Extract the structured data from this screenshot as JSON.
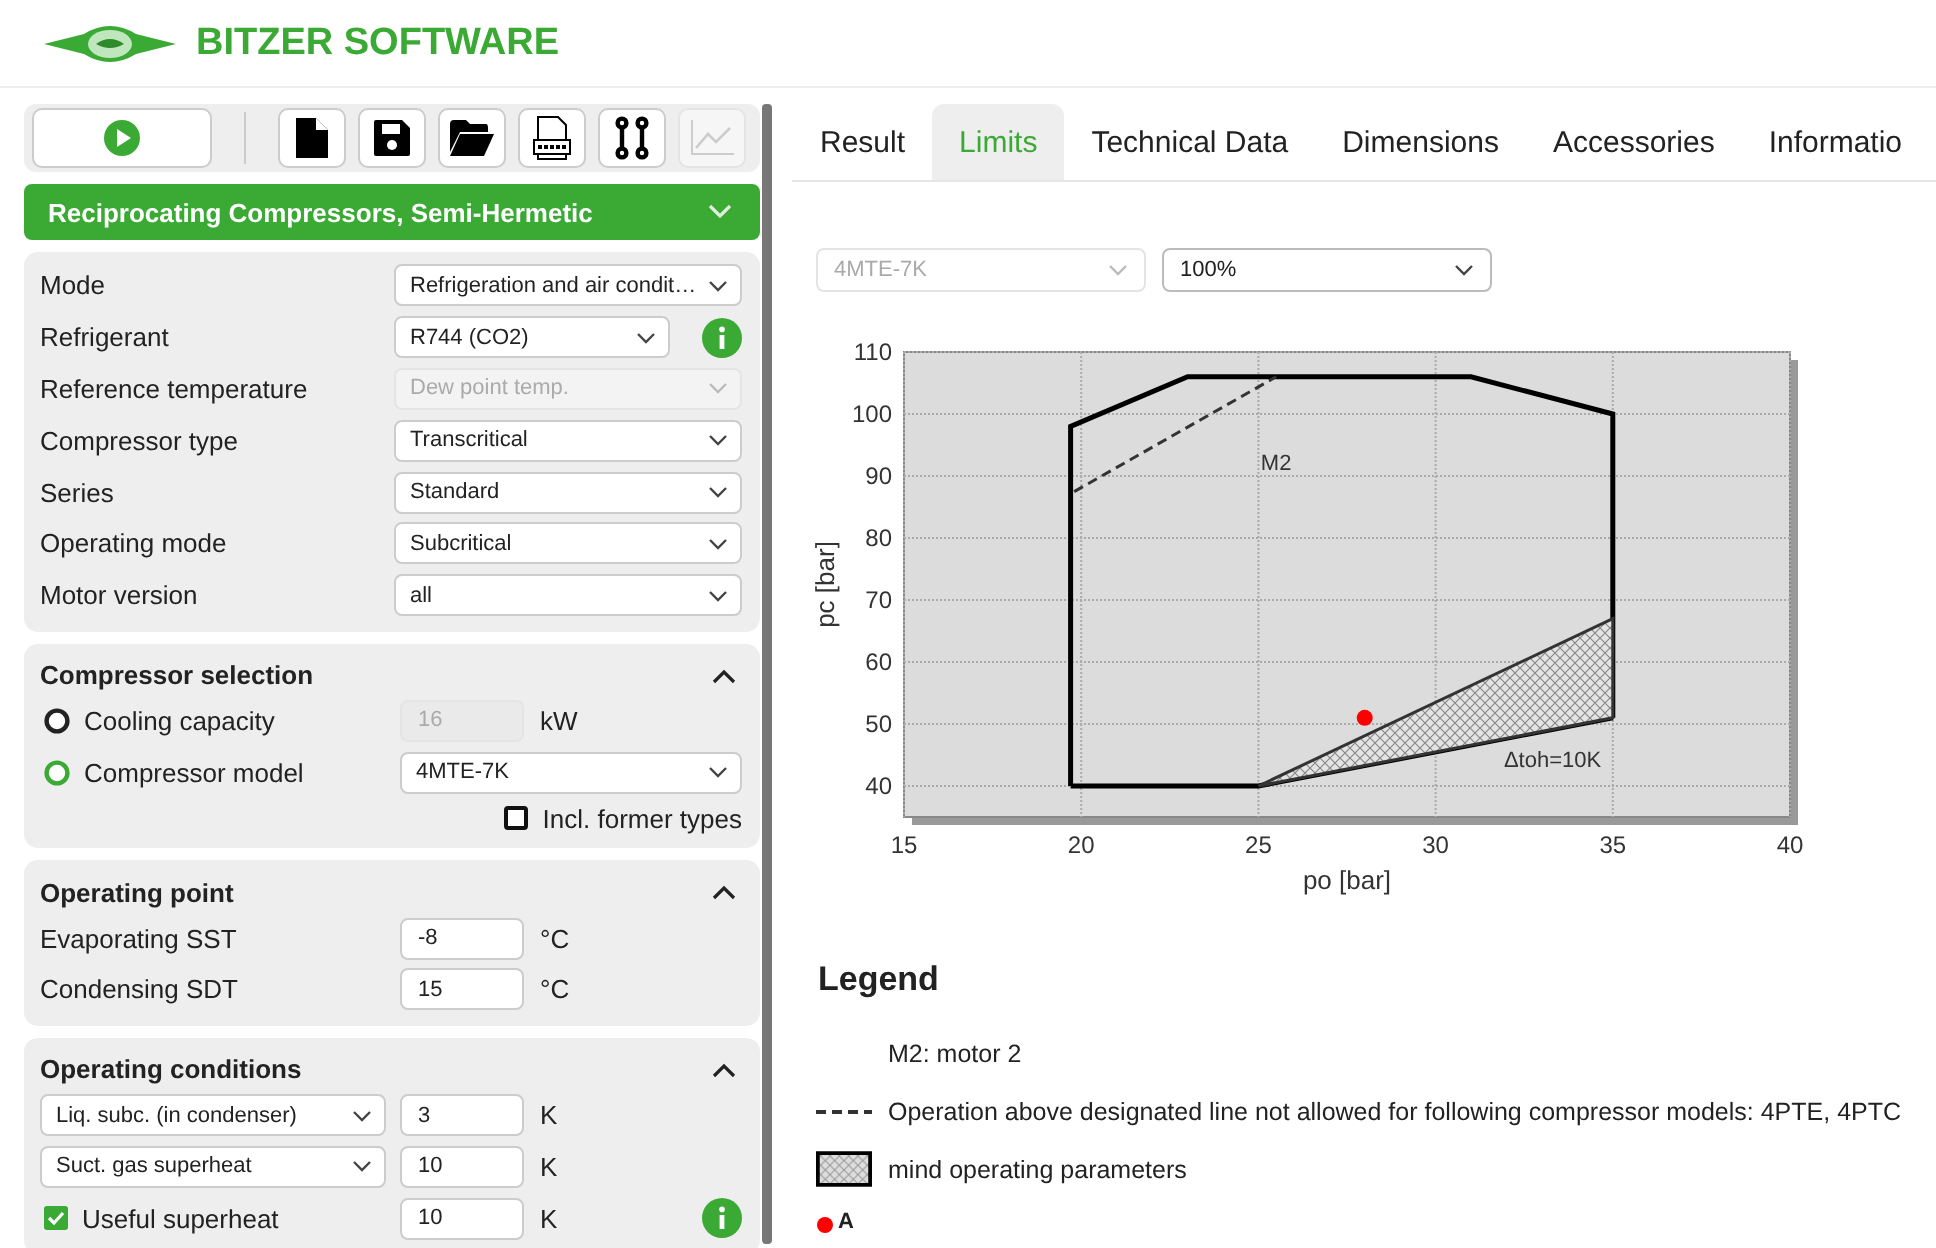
{
  "header": {
    "title": "BITZER SOFTWARE"
  },
  "toolbar": {
    "buttons": [
      {
        "kind": "play",
        "disabled": false
      },
      {
        "kind": "file",
        "disabled": false
      },
      {
        "kind": "save",
        "disabled": false
      },
      {
        "kind": "folder",
        "disabled": false
      },
      {
        "kind": "pdf",
        "disabled": false
      },
      {
        "kind": "compare",
        "disabled": false
      },
      {
        "kind": "chart",
        "disabled": true
      }
    ]
  },
  "product_group": {
    "label": "Reciprocating Compressors, Semi-Hermetic",
    "expanded": false
  },
  "settings": {
    "rows": [
      {
        "label": "Mode",
        "value": "Refrigeration and air condit…",
        "disabled": false,
        "info": false
      },
      {
        "label": "Refrigerant",
        "value": "R744 (CO2)",
        "disabled": false,
        "info": true
      },
      {
        "label": "Reference temperature",
        "value": "Dew point temp.",
        "disabled": true,
        "info": false
      },
      {
        "label": "Compressor type",
        "value": "Transcritical",
        "disabled": false,
        "info": false
      },
      {
        "label": "Series",
        "value": "Standard",
        "disabled": false,
        "info": false
      },
      {
        "label": "Operating mode",
        "value": "Subcritical",
        "disabled": false,
        "info": false
      },
      {
        "label": "Motor version",
        "value": "all",
        "disabled": false,
        "info": false
      }
    ]
  },
  "compressor_selection": {
    "title": "Compressor selection",
    "expanded": true,
    "options": [
      {
        "kind": "field",
        "label": "Cooling capacity",
        "selected": false,
        "value": "16",
        "unit": "kW",
        "disabled": true
      },
      {
        "kind": "select",
        "label": "Compressor model",
        "selected": true,
        "value": "4MTE-7K",
        "disabled": false
      }
    ],
    "former_types": {
      "label": "Incl. former types",
      "checked": false
    }
  },
  "operating_point": {
    "title": "Operating point",
    "expanded": true,
    "rows": [
      {
        "label": "Evaporating SST",
        "value": "-8",
        "unit": "°C"
      },
      {
        "label": "Condensing SDT",
        "value": "15",
        "unit": "°C"
      }
    ]
  },
  "operating_conditions": {
    "title": "Operating conditions",
    "expanded": true,
    "rows": [
      {
        "kind": "select",
        "label": "Liq. subc. (in condenser)",
        "value": "3",
        "unit": "K",
        "info": false
      },
      {
        "kind": "select",
        "label": "Suct. gas superheat",
        "value": "10",
        "unit": "K",
        "info": false
      },
      {
        "kind": "checkbox",
        "label": "Useful superheat",
        "checked": true,
        "value": "10",
        "unit": "K",
        "info": true
      }
    ]
  },
  "tabs": [
    {
      "label": "Result",
      "selected": false
    },
    {
      "label": "Limits",
      "selected": true
    },
    {
      "label": "Technical Data",
      "selected": false
    },
    {
      "label": "Dimensions",
      "selected": false
    },
    {
      "label": "Accessories",
      "selected": false
    },
    {
      "label": "Informatio",
      "selected": false
    }
  ],
  "limits": {
    "model_select": {
      "value": "4MTE-7K",
      "disabled": true
    },
    "load_select": {
      "value": "100%",
      "disabled": false
    },
    "chart_data": {
      "type": "line",
      "grid": true,
      "xlabel": "po [bar]",
      "ylabel": "pc [bar]",
      "xlim": [
        15,
        40
      ],
      "ylim": [
        35,
        110
      ],
      "xticks": [
        15,
        20,
        25,
        30,
        35,
        40
      ],
      "yticks": [
        40,
        50,
        60,
        70,
        80,
        90,
        100,
        110
      ],
      "series": [
        {
          "line_style": "solid",
          "color": "#000000",
          "x": [
            19.7,
            19.7,
            23,
            31,
            35,
            35
          ],
          "values": [
            40,
            98,
            106,
            106,
            100,
            51
          ]
        },
        {
          "line_style": "solid",
          "color": "#000000",
          "x": [
            19.7,
            25,
            35
          ],
          "values": [
            40,
            40,
            51
          ]
        },
        {
          "line_style": "dashed",
          "color": "#333333",
          "x": [
            19.8,
            25.5
          ],
          "values": [
            87.5,
            106
          ]
        },
        {
          "type": "area",
          "color": "#333333",
          "x": [
            25,
            35,
            35,
            25
          ],
          "values": [
            40,
            67,
            51,
            40
          ]
        },
        {
          "type": "scatter",
          "color": "#ff0000",
          "x": [
            28
          ],
          "values": [
            51
          ]
        }
      ],
      "annotations": [
        "M2",
        "Δtoh=10K"
      ]
    },
    "legend": {
      "title": "Legend",
      "items": [
        {
          "kind": "text",
          "label": "M2: motor 2"
        },
        {
          "kind": "dashed",
          "label": "Operation above designated line not allowed for following compressor models: 4PTE, 4PTC"
        },
        {
          "kind": "hatched",
          "label": "mind operating parameters"
        },
        {
          "kind": "point",
          "label": "A",
          "color": "#ff0000"
        }
      ]
    }
  }
}
